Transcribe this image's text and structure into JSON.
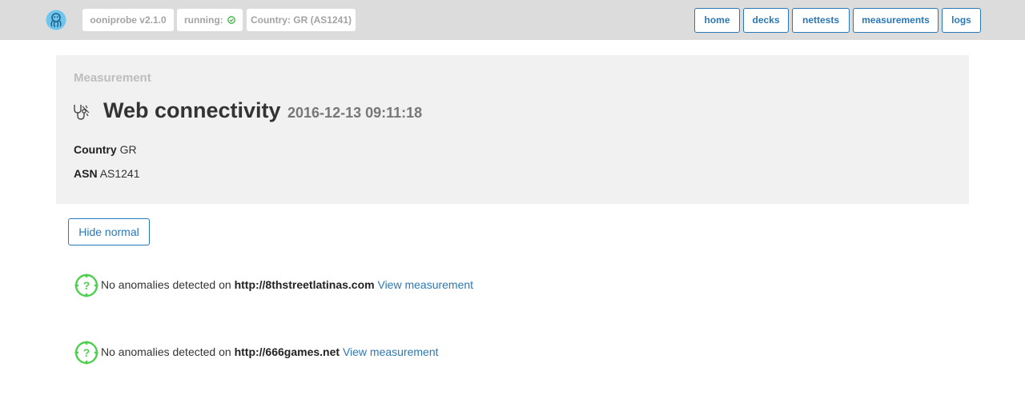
{
  "header": {
    "logo": "ooni-logo-icon",
    "version": "ooniprobe v2.1.0",
    "running_label": "running:",
    "running_status_icon": "check-circle-icon",
    "country": "Country: GR (AS1241)",
    "nav": {
      "home": "home",
      "decks": "decks",
      "nettests": "nettests",
      "measurements": "measurements",
      "logs": "logs"
    }
  },
  "measurement": {
    "label": "Measurement",
    "icon": "stethoscope-icon",
    "title": "Web connectivity",
    "timestamp": "2016-12-13 09:11:18",
    "country_label": "Country",
    "country_value": "GR",
    "asn_label": "ASN",
    "asn_value": "AS1241"
  },
  "controls": {
    "hide_normal": "Hide normal"
  },
  "results": [
    {
      "status_icon": "question-target-icon",
      "message": "No anomalies detected on",
      "url": "http://8thstreetlatinas.com",
      "link": "View measurement"
    },
    {
      "status_icon": "question-target-icon",
      "message": "No anomalies detected on",
      "url": "http://666games.net",
      "link": "View measurement"
    }
  ],
  "colors": {
    "accent": "#2a78b5",
    "ok": "#3cb043",
    "status": "#4fcf4f",
    "topbar": "#dcdcdc",
    "panel": "#f1f1f1"
  }
}
